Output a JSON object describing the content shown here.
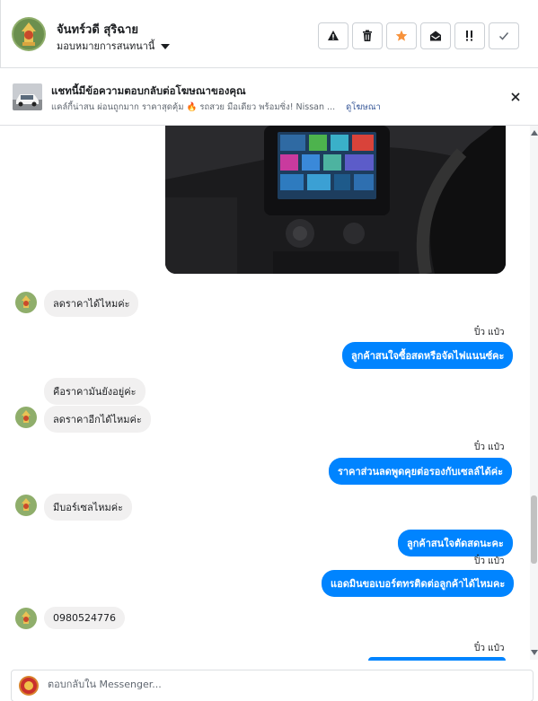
{
  "header": {
    "contact_name": "จันทร์วดี สุริฉาย",
    "assign_label": "มอบหมายการสนทนานี้",
    "actions": [
      {
        "name": "report-button",
        "icon": "warning-icon"
      },
      {
        "name": "delete-button",
        "icon": "trash-icon"
      },
      {
        "name": "star-button",
        "icon": "star-icon"
      },
      {
        "name": "mark-unread-button",
        "icon": "envelope-open-icon"
      },
      {
        "name": "follow-up-button",
        "icon": "exclamation-icon"
      },
      {
        "name": "done-button",
        "icon": "check-icon"
      }
    ],
    "star_color": "#f7923b"
  },
  "banner": {
    "title": "แชทนี้มีข้อความตอบกลับต่อโฆษณาของคุณ",
    "subtitle": "แคล์กี้น่าสน ผ่อนถูกมาก ราคาสุดคุ้ม 🔥 รถสวย มือเดียว พร้อมซิ่ง! Nissan ...",
    "link": "ดูโฆษณา"
  },
  "messages": {
    "in1": "ลดราคาได้ไหมค่ะ",
    "seen1": "ปิ๋ว แป๋ว",
    "out1": "ลูกค้าสนใจซื้อสดหรือจัดไฟแนนซ์คะ",
    "in2": "คือราคามันยังอยู่ค่ะ",
    "in3": "ลดราคาอีกได้ไหมค่ะ",
    "seen2": "ปิ๋ว แป๋ว",
    "out2": "ราคาส่วนลดพูดคุยต่อรองกับเซลล์ได้ค่ะ",
    "in4": "มีบอร์เซลไหมค่ะ",
    "out3": "ลูกค้าสนใจตัดสดนะคะ",
    "seen3": "ปิ๋ว แป๋ว",
    "out4": "แอดมินขอเบอร์ตทรติดต่อลูกค้าได้ไหมคะ",
    "in5": "0980524776",
    "seen4": "ปิ๋ว แป๋ว"
  },
  "composer": {
    "placeholder": "ตอบกลับใน Messenger..."
  },
  "colors": {
    "outgoing_bubble": "#0084ff",
    "incoming_bubble": "#f1f0f0"
  }
}
